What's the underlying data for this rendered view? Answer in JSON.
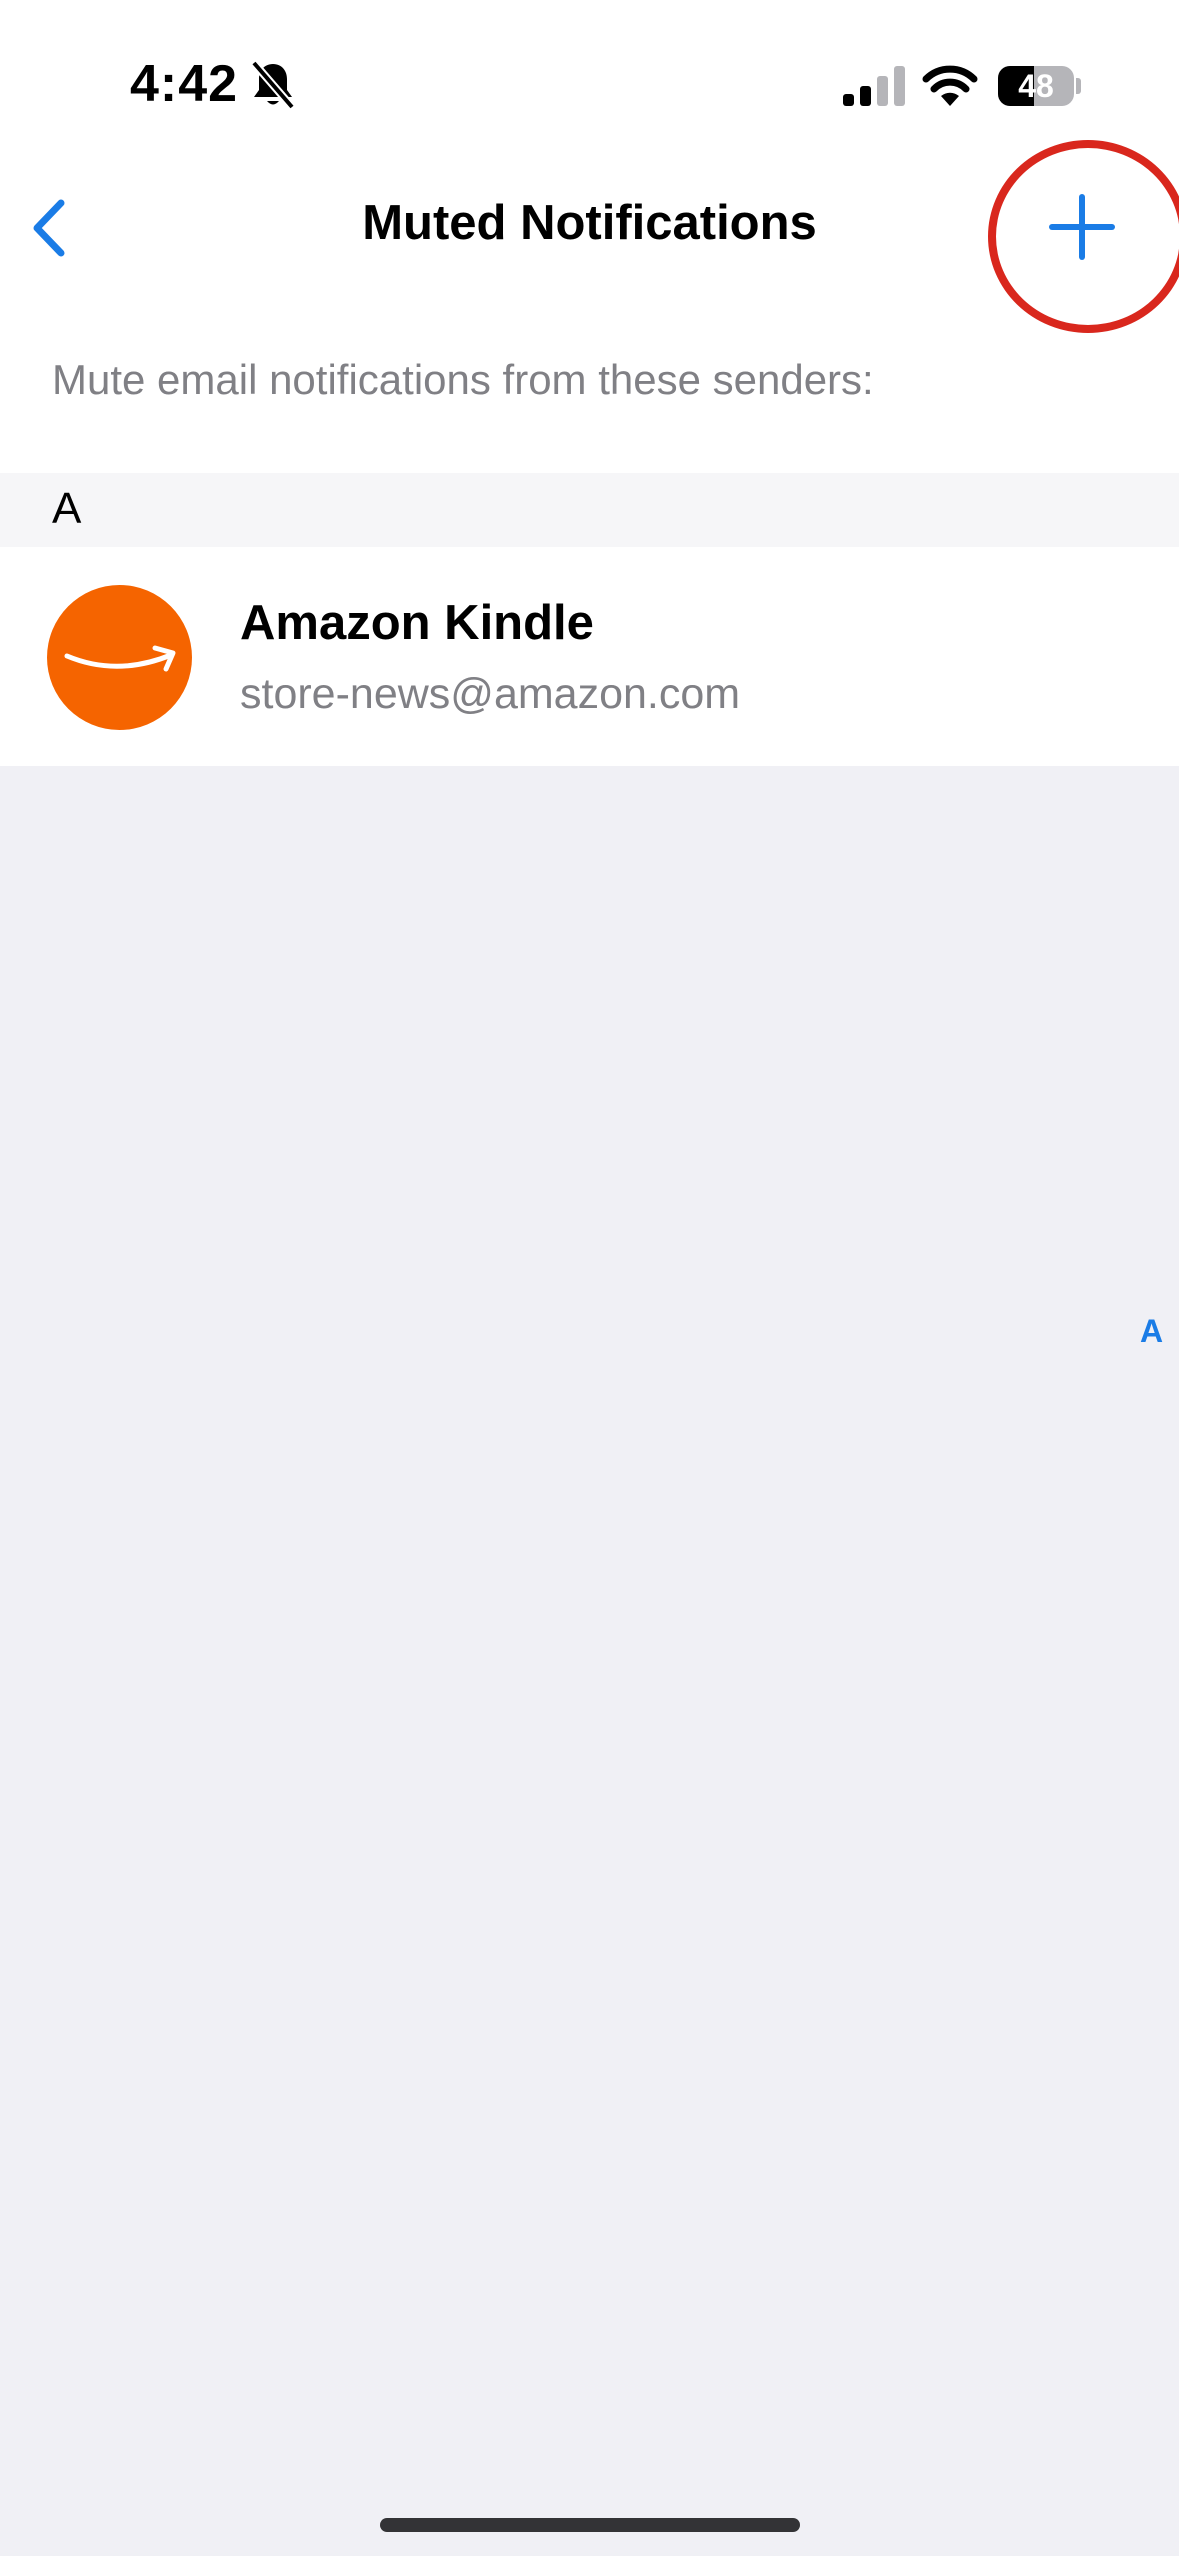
{
  "status_bar": {
    "time": "4:42",
    "battery_level": "48",
    "battery_fraction": 0.48
  },
  "nav": {
    "title": "Muted Notifications",
    "back_icon": "chevron-left-icon",
    "add_icon": "plus-icon"
  },
  "subtitle": "Mute email notifications from these senders:",
  "sections": [
    {
      "letter": "A",
      "senders": [
        {
          "name": "Amazon Kindle",
          "email": "store-news@amazon.com",
          "avatar_icon": "amazon-logo-icon",
          "avatar_color": "#f56400"
        }
      ]
    }
  ],
  "index_bar": [
    "A"
  ],
  "colors": {
    "accent": "#1a7ce6",
    "highlight_ring": "#d9271d",
    "secondary_text": "#808085",
    "grouped_background": "#f0f0f5"
  }
}
